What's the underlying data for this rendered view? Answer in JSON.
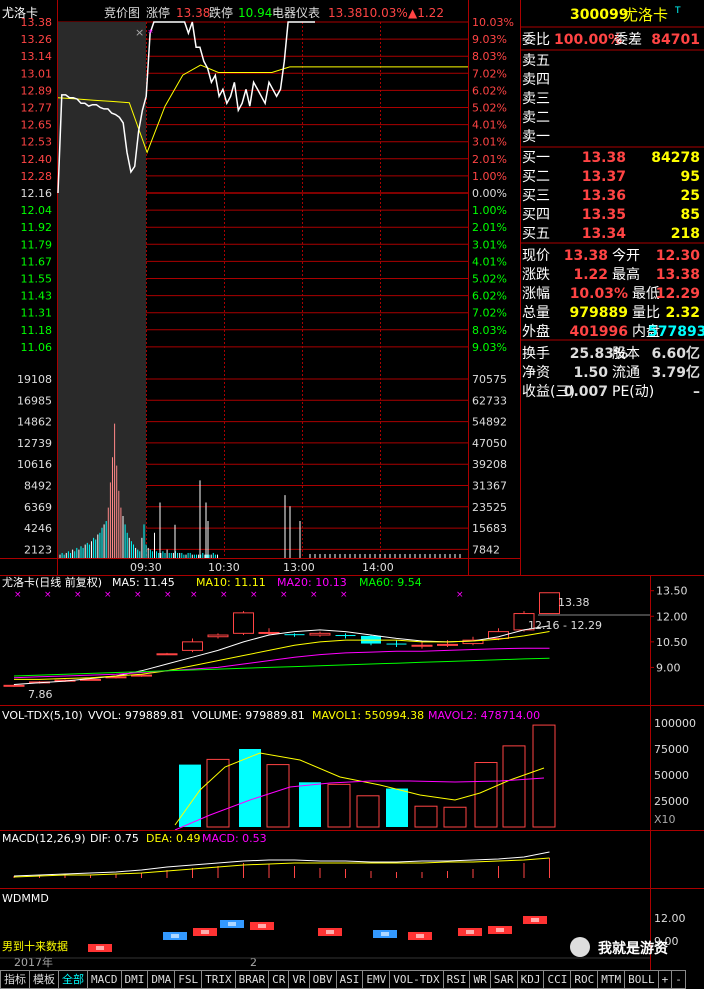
{
  "intraday": {
    "name": "尤洛卡",
    "labels": [
      "竞价图",
      "涨停",
      "跌停",
      "电器仪表"
    ],
    "limit_up": "13.38",
    "limit_down": "10.94",
    "price": "13.38",
    "pct": "10.03%",
    "change": "▲1.22",
    "price_ticks": [
      "13.38",
      "13.26",
      "13.14",
      "13.01",
      "12.89",
      "12.77",
      "12.65",
      "12.53",
      "12.40",
      "12.28",
      "12.16",
      "12.04",
      "11.92",
      "11.79",
      "11.67",
      "11.55",
      "11.43",
      "11.31",
      "11.18",
      "11.06"
    ],
    "pct_ticks": [
      "10.03%",
      "9.03%",
      "8.03%",
      "7.02%",
      "6.02%",
      "5.02%",
      "4.01%",
      "3.01%",
      "2.01%",
      "1.00%",
      "0.00%",
      "1.00%",
      "2.01%",
      "3.01%",
      "4.01%",
      "5.02%",
      "6.02%",
      "7.02%",
      "8.03%",
      "9.03%"
    ],
    "vol_ticks_left": [
      "19108",
      "16985",
      "14862",
      "12739",
      "10616",
      "8492",
      "6369",
      "4246",
      "2123"
    ],
    "vol_ticks_right": [
      "70575",
      "62733",
      "54892",
      "47050",
      "39208",
      "31367",
      "23525",
      "15683",
      "7842"
    ],
    "time_labels": [
      "09:30",
      "10:30",
      "13:00",
      "14:00"
    ]
  },
  "quote": {
    "code": "300099",
    "name": "尤洛卡",
    "weibi_label": "委比",
    "weibi": "100.00%",
    "weicha_label": "委差",
    "weicha": "84701",
    "sell": [
      "卖五",
      "卖四",
      "卖三",
      "卖二",
      "卖一"
    ],
    "buy": [
      {
        "label": "买一",
        "price": "13.38",
        "vol": "84278"
      },
      {
        "label": "买二",
        "price": "13.37",
        "vol": "95"
      },
      {
        "label": "买三",
        "price": "13.36",
        "vol": "25"
      },
      {
        "label": "买四",
        "price": "13.35",
        "vol": "85"
      },
      {
        "label": "买五",
        "price": "13.34",
        "vol": "218"
      }
    ],
    "stats": [
      {
        "l1": "现价",
        "v1": "13.38",
        "l2": "今开",
        "v2": "12.30"
      },
      {
        "l1": "涨跌",
        "v1": "1.22",
        "l2": "最高",
        "v2": "13.38"
      },
      {
        "l1": "涨幅",
        "v1": "10.03%",
        "l2": "最低",
        "v2": "12.29"
      },
      {
        "l1": "总量",
        "v1": "979889",
        "l2": "量比",
        "v2": "2.32"
      },
      {
        "l1": "外盘",
        "v1": "401996",
        "l2": "内盘",
        "v2": "577893"
      }
    ],
    "stats2": [
      {
        "l1": "换手",
        "v1": "25.83%",
        "l2": "股本",
        "v2": "6.60亿"
      },
      {
        "l1": "净资",
        "v1": "1.50",
        "l2": "流通",
        "v2": "3.79亿"
      },
      {
        "l1": "收益(三)",
        "v1": "0.007",
        "l2": "PE(动)",
        "v2": "–"
      }
    ]
  },
  "kline": {
    "header_name": "尤洛卡(日线 前复权)",
    "ma5": "MA5: 11.45",
    "ma10": "MA10: 11.11",
    "ma20": "MA20: 10.13",
    "ma60": "MA60: 9.54",
    "high_label": "13.38",
    "range_label": "12.16 - 12.29",
    "low_label": "7.86",
    "ticks": [
      "13.50",
      "12.00",
      "10.50",
      "9.00"
    ]
  },
  "volpanel": {
    "title": "VOL-TDX(5,10)",
    "vvol": "VVOL: 979889.81",
    "volume": "VOLUME: 979889.81",
    "mavol1": "MAVOL1: 550994.38",
    "mavol2": "MAVOL2: 478714.00",
    "ticks": [
      "100000",
      "75000",
      "50000",
      "25000"
    ],
    "unit": "X10"
  },
  "macd": {
    "title": "MACD(12,26,9)",
    "dif": "DIF: 0.75",
    "dea": "DEA: 0.49",
    "macd": "MACD: 0.53"
  },
  "wdmmd": {
    "title": "WDMMD",
    "ticks": [
      "12.00",
      "9.00"
    ],
    "note": "男到十来数据",
    "year": "2017年",
    "month": "2"
  },
  "watermark": "我就是游资",
  "tabs": [
    "指标",
    "模板",
    "全部",
    "MACD",
    "DMI",
    "DMA",
    "FSL",
    "TRIX",
    "BRAR",
    "CR",
    "VR",
    "OBV",
    "ASI",
    "EMV",
    "VOL-TDX",
    "RSI",
    "WR",
    "SAR",
    "KDJ",
    "CCI",
    "ROC",
    "MTM",
    "BOLL",
    "+",
    "-"
  ]
}
